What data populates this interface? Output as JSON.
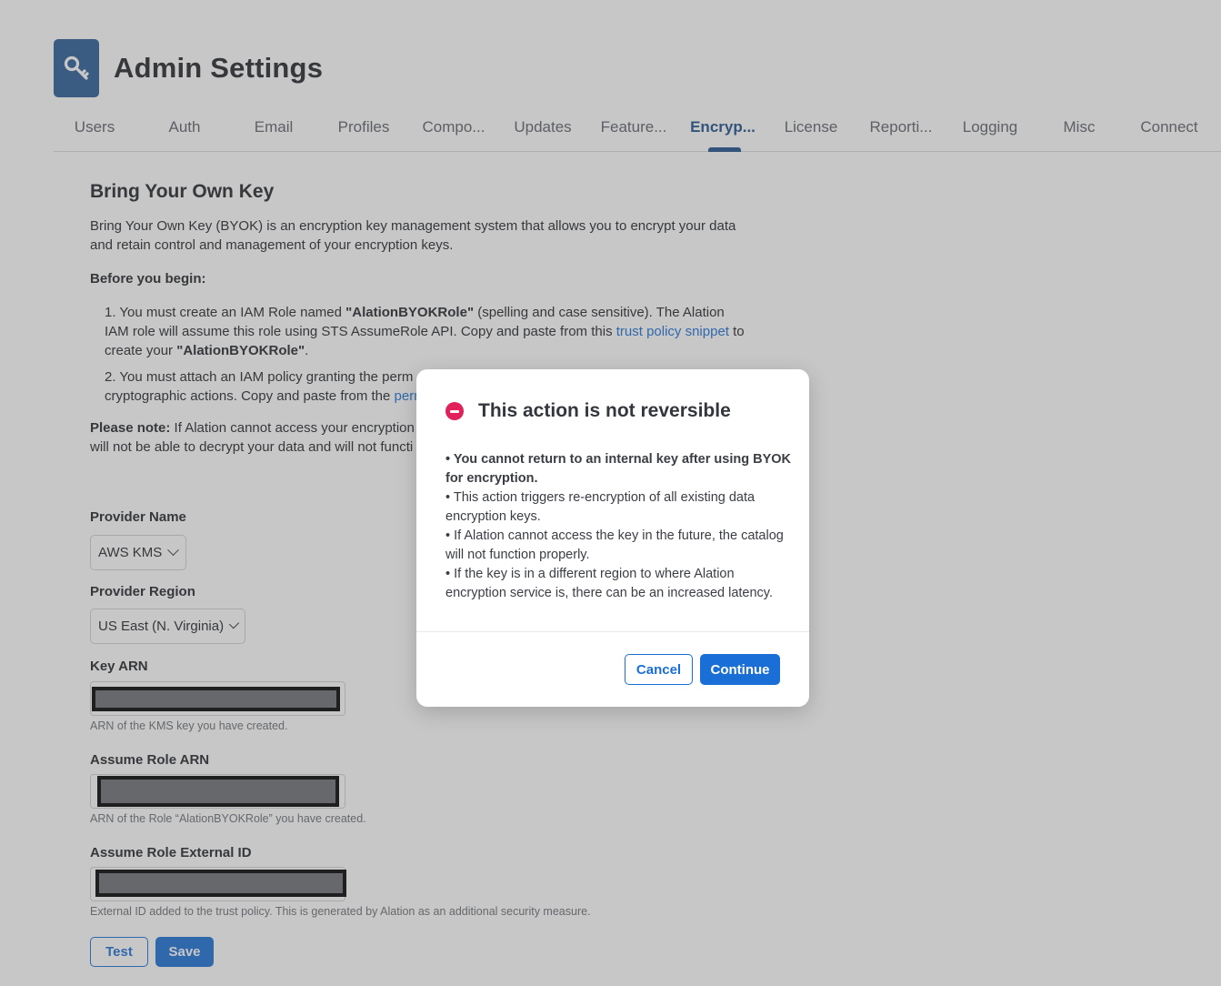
{
  "app": {
    "title": "Admin Settings"
  },
  "tabs": [
    {
      "label": "Users",
      "active": false
    },
    {
      "label": "Auth",
      "active": false
    },
    {
      "label": "Email",
      "active": false
    },
    {
      "label": "Profiles",
      "active": false
    },
    {
      "label": "Compo...",
      "active": false
    },
    {
      "label": "Updates",
      "active": false
    },
    {
      "label": "Feature...",
      "active": false
    },
    {
      "label": "Encryp...",
      "active": true
    },
    {
      "label": "License",
      "active": false
    },
    {
      "label": "Reporti...",
      "active": false
    },
    {
      "label": "Logging",
      "active": false
    },
    {
      "label": "Misc",
      "active": false
    },
    {
      "label": "Connect",
      "active": false
    }
  ],
  "byok": {
    "title": "Bring Your Own Key",
    "intro": "Bring Your Own Key (BYOK) is an encryption key management system that allows you to encrypt your data and retain control and management of your encryption keys.",
    "before_heading": "Before you begin:",
    "step1_prefix": "1. You must create an IAM Role named ",
    "role_name_quoted": "\"AlationBYOKRole\"",
    "step1_middle": " (spelling and case sensitive). The Alation IAM role will assume this role using STS AssumeRole API. Copy and paste from this ",
    "step1_link": "trust policy snippet",
    "step1_suffix1": " to create your ",
    "step1_suffix2": ".",
    "step2_text": "2. You must attach an IAM policy granting the perm",
    "step2_line2": "cryptographic actions. Copy and paste from the ",
    "step2_link": "perm",
    "note_label": "Please note:",
    "note_text": " If Alation cannot access your encryption k",
    "note_line2": "will not be able to decrypt your data and will not functi"
  },
  "form": {
    "provider_name_label": "Provider Name",
    "provider_name_value": "AWS KMS",
    "provider_region_label": "Provider Region",
    "provider_region_value": "US East (N. Virginia)",
    "key_arn_label": "Key ARN",
    "key_arn_help": "ARN of the KMS key you have created.",
    "assume_role_label": "Assume Role ARN",
    "assume_role_help": "ARN of the Role “AlationBYOKRole” you have created.",
    "external_id_label": "Assume Role External ID",
    "external_id_help": "External ID added to the trust policy. This is generated by Alation as an additional security measure.",
    "test_label": "Test",
    "save_label": "Save"
  },
  "modal": {
    "title": "This action is not reversible",
    "bullet1": "• You cannot return to an internal key after using BYOK for encryption.",
    "bullet2": "• This action triggers re-encryption of all existing data encryption keys.",
    "bullet3": "• If Alation cannot access the key in the future, the catalog will not function properly.",
    "bullet4": "• If the key is in a different region to where Alation encryption service is, there can be an increased latency.",
    "cancel_label": "Cancel",
    "continue_label": "Continue"
  },
  "colors": {
    "accent": "#1a6fd6",
    "brand": "#2b5d97",
    "danger": "#e0215a"
  }
}
